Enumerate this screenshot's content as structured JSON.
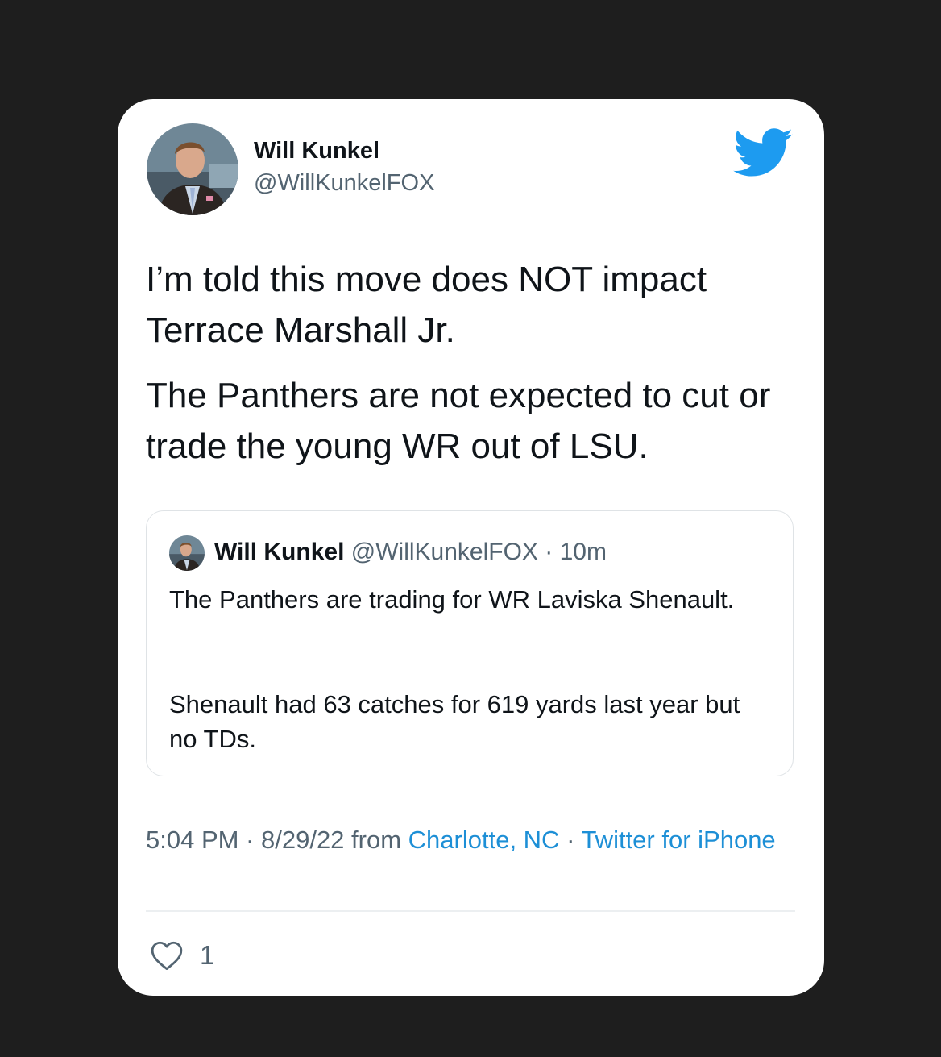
{
  "colors": {
    "background": "#1e1e1e",
    "card": "#ffffff",
    "text_primary": "#0f1419",
    "text_secondary": "#536471",
    "link": "#1d8fd6",
    "twitter_blue": "#1d9bf0"
  },
  "icons": {
    "logo": "twitter-bird-icon",
    "like": "heart-outline-icon"
  },
  "tweet": {
    "author": {
      "name": "Will Kunkel",
      "handle": "@WillKunkelFOX"
    },
    "paragraphs": [
      "I’m told this move does NOT impact Terrace Marshall Jr.",
      "The Panthers are not expected to cut or trade the young WR out of LSU."
    ],
    "quoted": {
      "name": "Will Kunkel",
      "meta": "@WillKunkelFOX · 10m",
      "paragraphs": [
        "The Panthers are trading for WR Laviska Shenault.",
        "Shenault had 63 catches for 619 yards last year but no TDs."
      ]
    },
    "timestamp": "5:04 PM · 8/29/22 from ",
    "location": "Charlotte, NC",
    "separator": " · ",
    "source": "Twitter for iPhone",
    "likes": "1"
  }
}
